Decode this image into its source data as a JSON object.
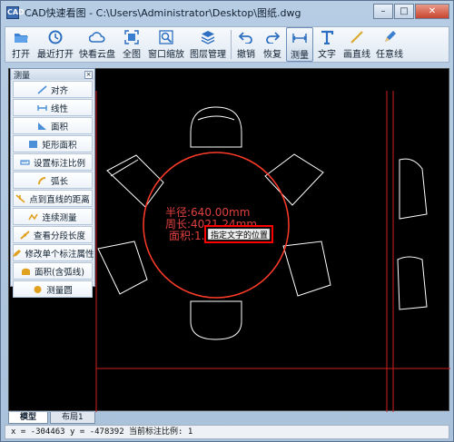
{
  "window": {
    "title": "CAD快速看图 - C:\\Users\\Administrator\\Desktop\\图纸.dwg",
    "app_icon": "CAD"
  },
  "toolbar": {
    "items": [
      {
        "label": "打开",
        "icon": "folder-open-icon"
      },
      {
        "label": "最近打开",
        "icon": "recent-icon"
      },
      {
        "label": "快看云盘",
        "icon": "cloud-icon"
      },
      {
        "label": "全图",
        "icon": "fit-all-icon"
      },
      {
        "label": "窗口缩放",
        "icon": "zoom-window-icon"
      },
      {
        "label": "图层管理",
        "icon": "layers-icon"
      },
      {
        "label": "撤销",
        "icon": "undo-icon"
      },
      {
        "label": "恢复",
        "icon": "redo-icon"
      },
      {
        "label": "测量",
        "icon": "measure-icon"
      },
      {
        "label": "文字",
        "icon": "text-icon"
      },
      {
        "label": "画直线",
        "icon": "line-icon"
      },
      {
        "label": "任意线",
        "icon": "pencil-icon"
      }
    ]
  },
  "measure_panel": {
    "title": "测量",
    "items": [
      {
        "label": "对齐",
        "icon": "align-measure-icon",
        "color": "#4a8fd8"
      },
      {
        "label": "线性",
        "icon": "linear-measure-icon",
        "color": "#4a8fd8"
      },
      {
        "label": "面积",
        "icon": "area-icon",
        "color": "#4a8fd8"
      },
      {
        "label": "矩形面积",
        "icon": "rect-area-icon",
        "color": "#4a8fd8"
      },
      {
        "label": "设置标注比例",
        "icon": "scale-icon",
        "color": "#4a8fd8"
      },
      {
        "label": "弧长",
        "icon": "arc-length-icon",
        "color": "#e0a020"
      },
      {
        "label": "点到直线的距离",
        "icon": "point-line-icon",
        "color": "#e0a020"
      },
      {
        "label": "连续测量",
        "icon": "continuous-icon",
        "color": "#e0a020"
      },
      {
        "label": "查看分段长度",
        "icon": "segment-icon",
        "color": "#e0a020"
      },
      {
        "label": "修改单个标注属性",
        "icon": "edit-annotation-icon",
        "color": "#e0a020"
      },
      {
        "label": "面积(含弧线)",
        "icon": "arc-area-icon",
        "color": "#e0a020"
      },
      {
        "label": "测量圆",
        "icon": "circle-measure-icon",
        "color": "#e0a020"
      }
    ]
  },
  "drawing": {
    "radius_text": "半径:640.00mm",
    "perimeter_text": "周长:4021.24mm",
    "area_text": "面积:1.28",
    "tooltip": "指定文字的位置",
    "colors": {
      "background": "#000000",
      "lines": "#ffffff",
      "measure": "#e02020",
      "highlight": "#ff0000"
    }
  },
  "tabs": [
    {
      "label": "模型",
      "active": true
    },
    {
      "label": "布局1",
      "active": false
    }
  ],
  "status": {
    "text": "x = -304463 y = -478392 当前标注比例: 1"
  }
}
